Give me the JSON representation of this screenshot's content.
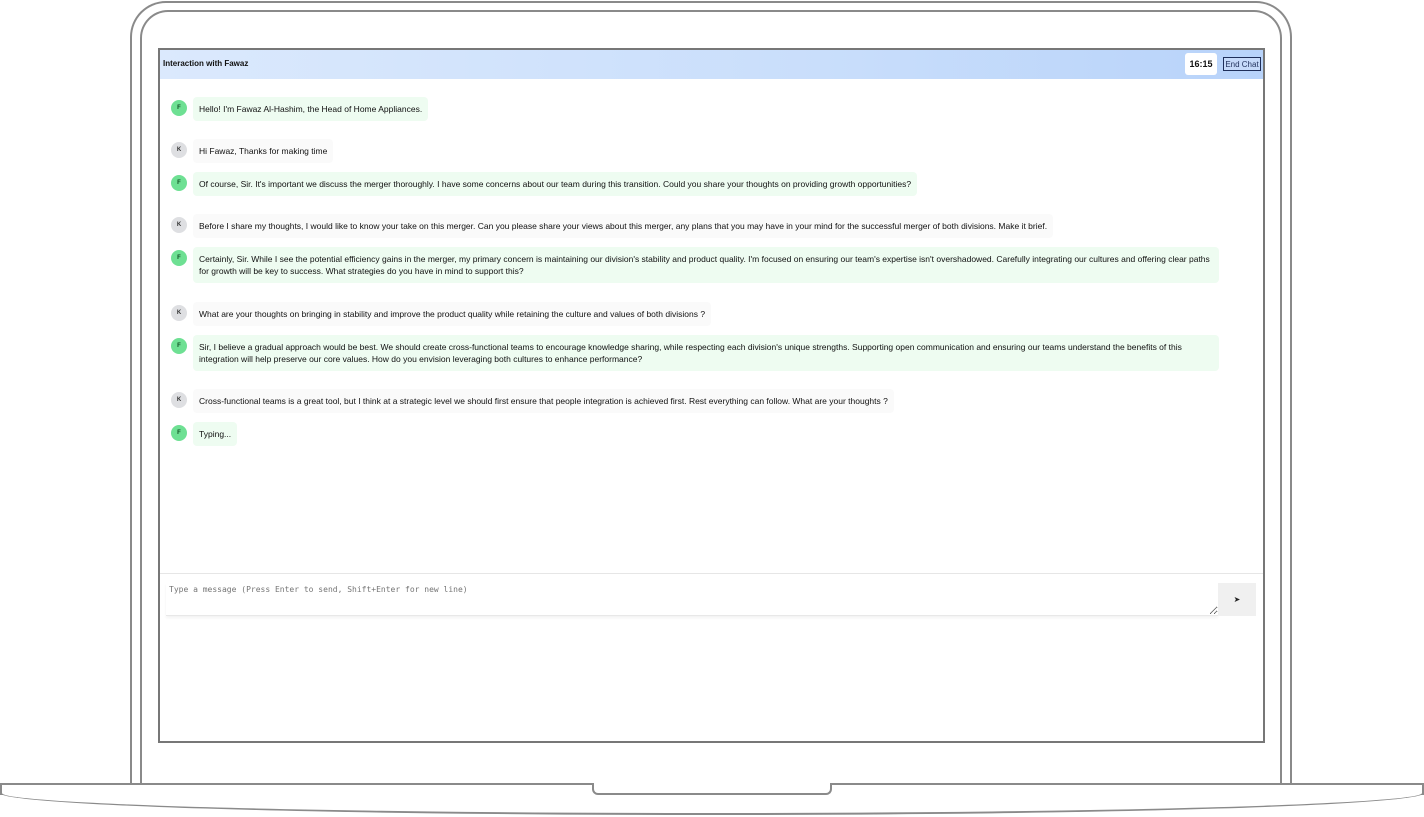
{
  "header": {
    "title": "Interaction with Fawaz",
    "timer": "16:15",
    "end_chat_label": "End Chat"
  },
  "messages": [
    {
      "sender": "F",
      "text": "Hello! I'm Fawaz Al-Hashim, the Head of Home Appliances."
    },
    {
      "sender": "K",
      "text": "Hi Fawaz, Thanks for making time"
    },
    {
      "sender": "F",
      "text": "Of course, Sir. It's important we discuss the merger thoroughly. I have some concerns about our team during this transition. Could you share your thoughts on providing growth opportunities?"
    },
    {
      "sender": "K",
      "text": "Before I share my thoughts, I would like to know your take on this merger. Can you please share your views about this merger, any plans that you may have in your mind for the successful merger of both divisions. Make it brief."
    },
    {
      "sender": "F",
      "text": "Certainly, Sir. While I see the potential efficiency gains in the merger, my primary concern is maintaining our division's stability and product quality. I'm focused on ensuring our team's expertise isn't overshadowed. Carefully integrating our cultures and offering clear paths for growth will be key to success. What strategies do you have in mind to support this?"
    },
    {
      "sender": "K",
      "text": "What are your thoughts on bringing in stability and improve the product quality while retaining the culture and values of both divisions ?"
    },
    {
      "sender": "F",
      "text": "Sir, I believe a gradual approach would be best. We should create cross-functional teams to encourage knowledge sharing, while respecting each division's unique strengths. Supporting open communication and ensuring our teams understand the benefits of this integration will help preserve our core values. How do you envision leveraging both cultures to enhance performance?"
    },
    {
      "sender": "K",
      "text": "Cross-functional teams is a great tool, but I think at a strategic level we should first ensure that people integration is achieved first.  Rest everything can follow. What are your thoughts ?"
    },
    {
      "sender": "F",
      "text": "Typing..."
    }
  ],
  "composer": {
    "placeholder": "Type a message (Press Enter to send, Shift+Enter for new line)",
    "send_icon": "➤"
  },
  "icons": {
    "send": "send-arrow-icon"
  }
}
